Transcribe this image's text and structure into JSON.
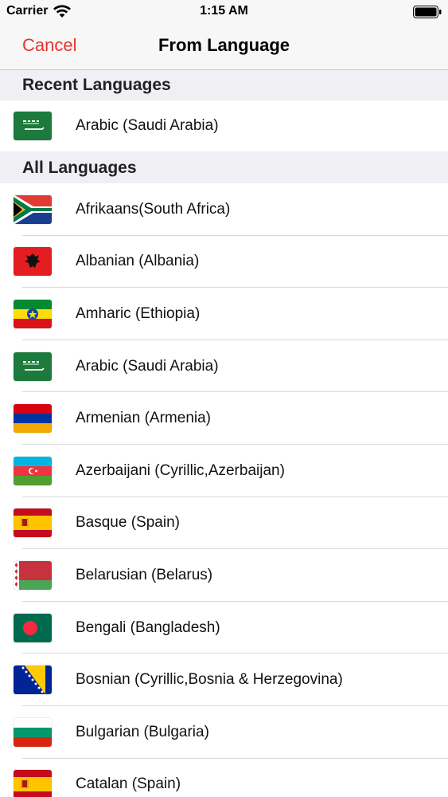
{
  "status_bar": {
    "carrier": "Carrier",
    "time": "1:15 AM",
    "wifi_icon": "wifi-icon",
    "battery_icon": "battery-icon"
  },
  "nav": {
    "cancel_label": "Cancel",
    "title": "From Language",
    "accent_color": "#e8322f"
  },
  "recent": {
    "header": "Recent Languages",
    "items": [
      {
        "label": "Arabic (Saudi Arabia)",
        "flag_icon": "saudi-arabia-flag-icon"
      }
    ]
  },
  "all": {
    "header": "All Languages",
    "items": [
      {
        "label": "Afrikaans(South Africa)",
        "flag_icon": "south-africa-flag-icon"
      },
      {
        "label": "Albanian (Albania)",
        "flag_icon": "albania-flag-icon"
      },
      {
        "label": "Amharic (Ethiopia)",
        "flag_icon": "ethiopia-flag-icon"
      },
      {
        "label": "Arabic (Saudi Arabia)",
        "flag_icon": "saudi-arabia-flag-icon"
      },
      {
        "label": "Armenian (Armenia)",
        "flag_icon": "armenia-flag-icon"
      },
      {
        "label": "Azerbaijani (Cyrillic,Azerbaijan)",
        "flag_icon": "azerbaijan-flag-icon"
      },
      {
        "label": "Basque (Spain)",
        "flag_icon": "spain-flag-icon"
      },
      {
        "label": "Belarusian (Belarus)",
        "flag_icon": "belarus-flag-icon"
      },
      {
        "label": "Bengali (Bangladesh)",
        "flag_icon": "bangladesh-flag-icon"
      },
      {
        "label": "Bosnian (Cyrillic,Bosnia & Herzegovina)",
        "flag_icon": "bosnia-flag-icon"
      },
      {
        "label": "Bulgarian (Bulgaria)",
        "flag_icon": "bulgaria-flag-icon"
      },
      {
        "label": "Catalan (Spain)",
        "flag_icon": "spain-flag-icon"
      }
    ]
  }
}
